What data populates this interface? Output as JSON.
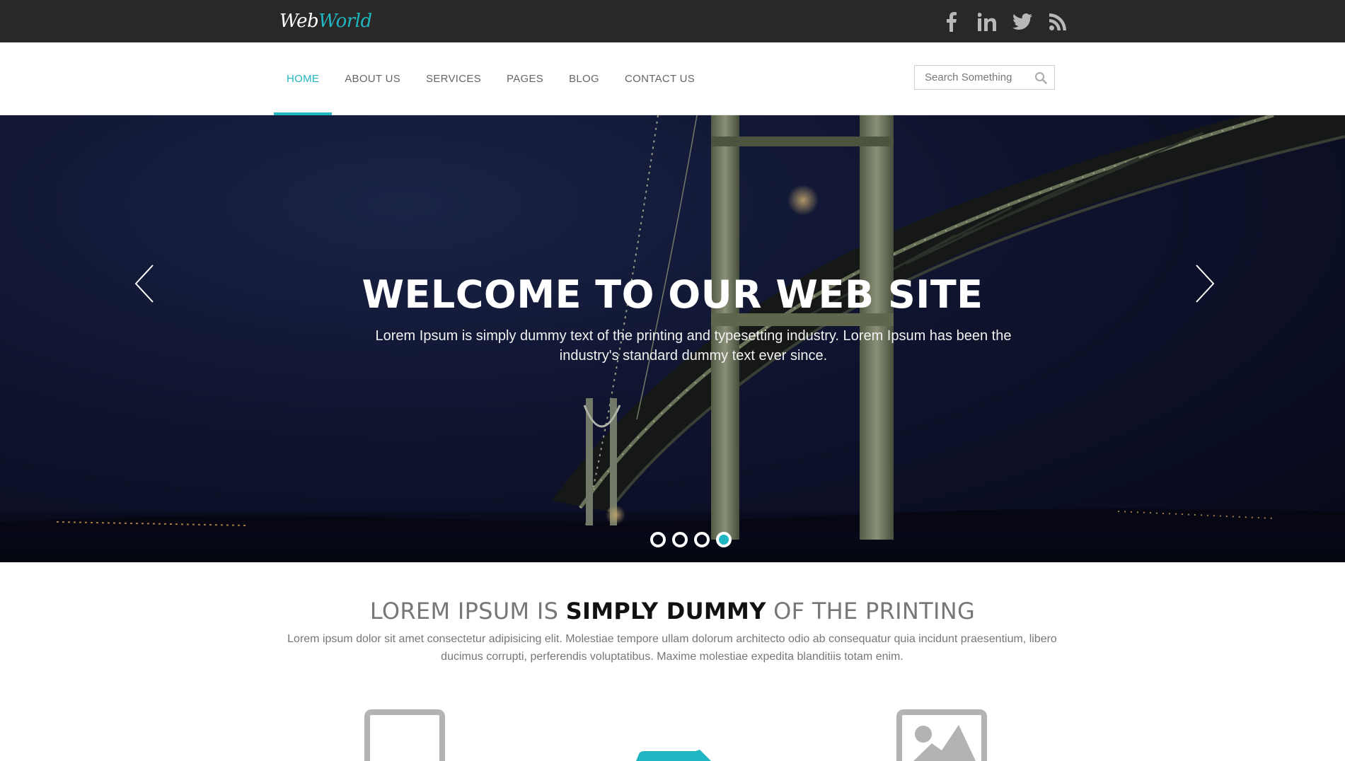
{
  "brand": {
    "part1": "Web",
    "part2": "World"
  },
  "social": [
    "facebook-icon",
    "linkedin-icon",
    "twitter-icon",
    "rss-icon"
  ],
  "nav": {
    "items": [
      {
        "label": "HOME",
        "active": true
      },
      {
        "label": "ABOUT US",
        "active": false
      },
      {
        "label": "SERVICES",
        "active": false
      },
      {
        "label": "PAGES",
        "active": false
      },
      {
        "label": "BLOG",
        "active": false
      },
      {
        "label": "CONTACT US",
        "active": false
      }
    ]
  },
  "search": {
    "placeholder": "Search Something",
    "value": ""
  },
  "hero": {
    "title": "WELCOME TO OUR WEB SITE",
    "text": "Lorem Ipsum is simply dummy text of the printing and typesetting industry. Lorem Ipsum has been the industry's standard dummy text ever since.",
    "slides": 4,
    "active_slide": 4
  },
  "intro": {
    "title_pre": "LOREM IPSUM IS ",
    "title_bold": "SIMPLY DUMMY",
    "title_post": " OF THE PRINTING",
    "text": "Lorem ipsum dolor sit amet consectetur adipisicing elit. Molestiae tempore ullam dolorum architecto odio ab consequatur quia incidunt praesentium, libero ducimus corrupti, perferendis voluptatibus. Maxime molestiae expedita blanditiis totam enim."
  },
  "features": [
    "monitor-icon",
    "pencil-icon",
    "image-icon"
  ],
  "colors": {
    "accent": "#1fb5c1",
    "topbar": "#2a2727",
    "icon_gray": "#b3b3b3"
  }
}
